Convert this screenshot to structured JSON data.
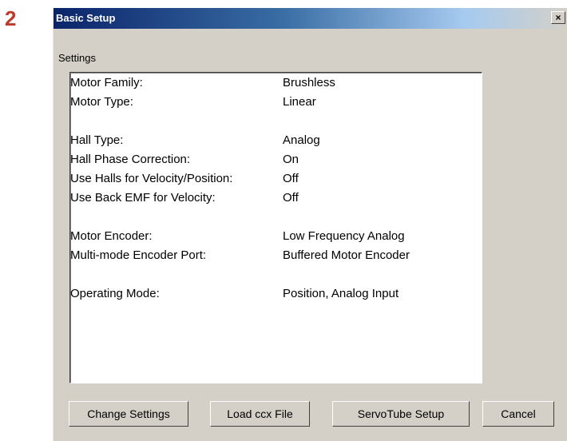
{
  "step_number": "2",
  "dialog": {
    "title": "Basic Setup",
    "close_label": "×"
  },
  "settings": {
    "label": "Settings",
    "rows": [
      {
        "label": "Motor Family:",
        "value": "Brushless"
      },
      {
        "label": "Motor Type:",
        "value": "Linear"
      },
      {
        "label": "Hall Type:",
        "value": "Analog"
      },
      {
        "label": "Hall Phase Correction:",
        "value": "On"
      },
      {
        "label": "Use Halls for Velocity/Position:",
        "value": "Off"
      },
      {
        "label": "Use Back EMF for Velocity:",
        "value": "Off"
      },
      {
        "label": "Motor Encoder:",
        "value": "Low Frequency Analog"
      },
      {
        "label": "Multi-mode Encoder Port:",
        "value": "Buffered Motor Encoder"
      },
      {
        "label": "Operating Mode:",
        "value": "Position, Analog Input"
      }
    ]
  },
  "buttons": {
    "change_settings": "Change Settings",
    "load_ccx": "Load ccx File",
    "servotube_setup": "ServoTube Setup",
    "cancel": "Cancel"
  }
}
